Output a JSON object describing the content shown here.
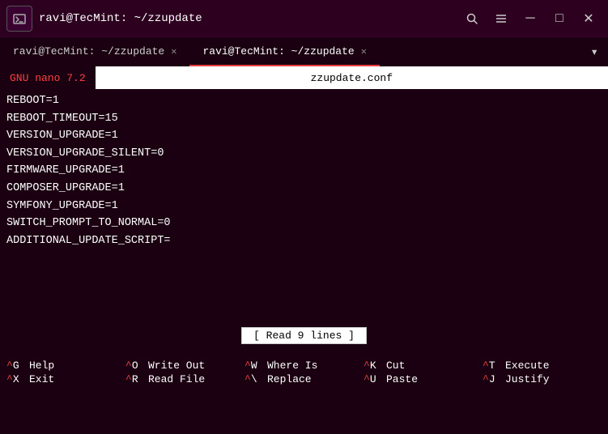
{
  "titlebar": {
    "title": "ravi@TecMint: ~/zzupdate",
    "icon": "❐",
    "search_icon": "🔍",
    "menu_icon": "☰",
    "minimize_icon": "─",
    "maximize_icon": "□",
    "close_icon": "✕"
  },
  "tabs": [
    {
      "label": "ravi@TecMint: ~/zzupdate",
      "active": false,
      "close": "✕"
    },
    {
      "label": "ravi@TecMint: ~/zzupdate",
      "active": true,
      "close": "✕"
    }
  ],
  "tab_dropdown": "▾",
  "nano_header": {
    "version": "GNU nano 7.2",
    "filename": "zzupdate.conf"
  },
  "editor_lines": [
    "REBOOT=1",
    "REBOOT_TIMEOUT=15",
    "VERSION_UPGRADE=1",
    "VERSION_UPGRADE_SILENT=0",
    "FIRMWARE_UPGRADE=1",
    "COMPOSER_UPGRADE=1",
    "SYMFONY_UPGRADE=1",
    "SWITCH_PROMPT_TO_NORMAL=0",
    "ADDITIONAL_UPDATE_SCRIPT="
  ],
  "status_message": "[ Read 9 lines ]",
  "shortcuts": [
    [
      {
        "key": "^G",
        "desc": "Help"
      },
      {
        "key": "^X",
        "desc": "Exit"
      }
    ],
    [
      {
        "key": "^O",
        "desc": "Write Out"
      },
      {
        "key": "^R",
        "desc": "Read File"
      }
    ],
    [
      {
        "key": "^W",
        "desc": "Where Is"
      },
      {
        "key": "^\\",
        "desc": "Replace"
      }
    ],
    [
      {
        "key": "^K",
        "desc": "Cut"
      },
      {
        "key": "^U",
        "desc": "Paste"
      }
    ],
    [
      {
        "key": "^T",
        "desc": "Execute"
      },
      {
        "key": "^J",
        "desc": "Justify"
      }
    ]
  ]
}
